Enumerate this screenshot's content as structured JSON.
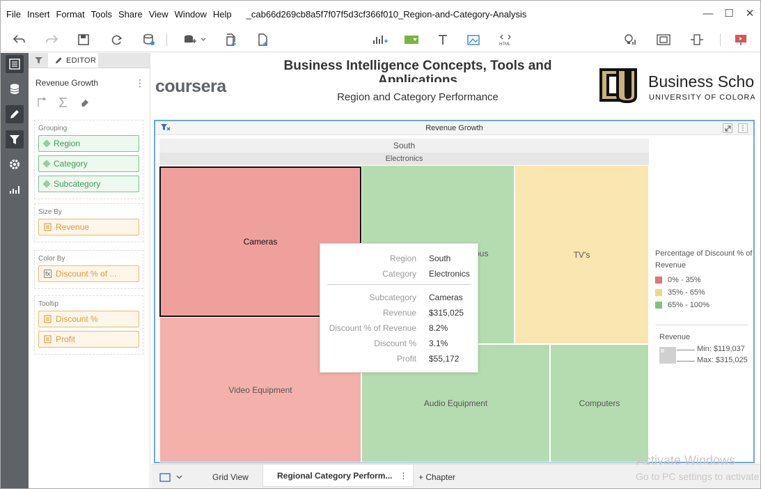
{
  "menu": [
    "File",
    "Insert",
    "Format",
    "Tools",
    "Share",
    "View",
    "Window",
    "Help"
  ],
  "document_title": "_cab66d269cb8a5f7f07f5d3cf366f010_Region-and-Category-Analysis",
  "editor": {
    "tab_label": "EDITOR",
    "widget_name": "Revenue Growth",
    "grouping_title": "Grouping",
    "grouping": [
      "Region",
      "Category",
      "Subcategory"
    ],
    "size_by_title": "Size By",
    "size_by": "Revenue",
    "color_by_title": "Color By",
    "color_by": "Discount % of ...",
    "tooltip_title": "Tooltip",
    "tooltip_fields": [
      "Discount %",
      "Profit"
    ]
  },
  "report": {
    "logo_text": "coursera",
    "title": "Business Intelligence Concepts, Tools and Applications",
    "subtitle": "Region and Category Performance",
    "school_name": "Business Scho",
    "school_sub": "UNIVERSITY OF COLORADO"
  },
  "widget": {
    "title": "Revenue Growth",
    "region_header": "South",
    "category_header": "Electronics"
  },
  "chart_data": {
    "type": "treemap",
    "groups": [
      "South",
      "Electronics"
    ],
    "tiles": [
      {
        "label": "Cameras",
        "color_bucket": "0% - 35%",
        "selected": true
      },
      {
        "label": "...ous",
        "color_bucket": "65% - 100%"
      },
      {
        "label": "TV's",
        "color_bucket": "35% - 65%"
      },
      {
        "label": "Video Equipment",
        "color_bucket": "0% - 35%"
      },
      {
        "label": "Audio Equipment",
        "color_bucket": "65% - 100%"
      },
      {
        "label": "Computers",
        "color_bucket": "65% - 100%"
      }
    ],
    "legend_title": "Percentage of Discount % of Revenue",
    "legend": [
      {
        "label": "0% - 35%",
        "color": "#e57373"
      },
      {
        "label": "35% - 65%",
        "color": "#f5d77a"
      },
      {
        "label": "65% - 100%",
        "color": "#7cc47c"
      }
    ],
    "size_legend_title": "Revenue",
    "size_min": "Min: $119,037",
    "size_max": "Max: $315,025"
  },
  "tooltip": {
    "rows": [
      {
        "label": "Region",
        "value": "South"
      },
      {
        "label": "Category",
        "value": "Electronics"
      },
      {
        "label": "Subcategory",
        "value": "Cameras"
      },
      {
        "label": "Revenue",
        "value": "$315,025"
      },
      {
        "label": "Discount % of Revenue",
        "value": "8.2%"
      },
      {
        "label": "Discount %",
        "value": "3.1%"
      },
      {
        "label": "Profit",
        "value": "$55,172"
      }
    ]
  },
  "bottom_tabs": {
    "grid_view": "Grid View",
    "active": "Regional Category Perform...",
    "add_chapter": "+ Chapter"
  },
  "watermark": {
    "line1": "Activate Windows",
    "line2": "Go to PC settings to activate"
  },
  "colors": {
    "tile_cameras": "#f0a09c",
    "tile_video": "#f4b0ab",
    "tile_green": "#b4dcb0",
    "tile_yellow": "#f9e6b0",
    "widget_border": "#6ea6dc"
  }
}
